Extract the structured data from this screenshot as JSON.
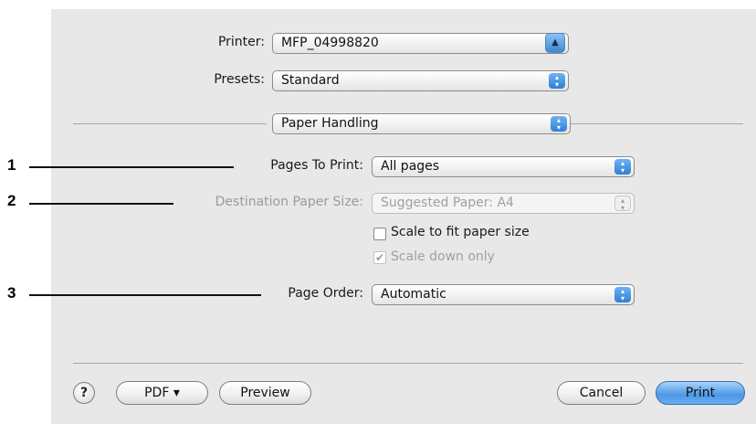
{
  "printer": {
    "label": "Printer:",
    "value": "MFP_04998820"
  },
  "presets": {
    "label": "Presets:",
    "value": "Standard"
  },
  "panel": {
    "value": "Paper Handling"
  },
  "pages_to_print": {
    "label": "Pages To Print:",
    "value": "All pages"
  },
  "destination_paper_size": {
    "label": "Destination Paper Size:",
    "value": "Suggested Paper: A4"
  },
  "scale_to_fit": {
    "label": "Scale to fit paper size",
    "checked": false
  },
  "scale_down_only": {
    "label": "Scale down only",
    "checked": true,
    "enabled": false
  },
  "page_order": {
    "label": "Page Order:",
    "value": "Automatic"
  },
  "callouts": [
    "1",
    "2",
    "3"
  ],
  "buttons": {
    "help": "?",
    "pdf": "PDF ▾",
    "preview": "Preview",
    "cancel": "Cancel",
    "print": "Print"
  },
  "icons": {
    "disclosure": "▲",
    "stepper": "▴▾",
    "checkmark": "✔"
  },
  "colors": {
    "dialog_bg": "#e8e8e8",
    "accent": "#3c88d8",
    "disabled_text": "#9a9a9a"
  }
}
